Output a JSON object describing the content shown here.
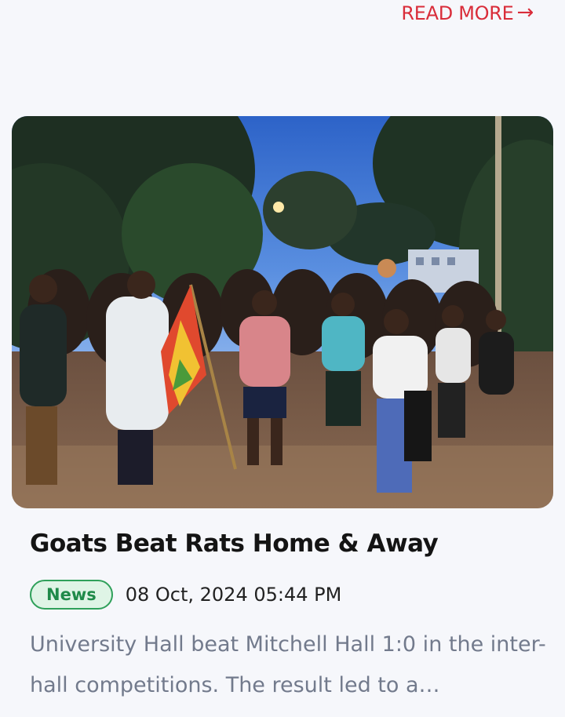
{
  "read_more": {
    "label": "READ MORE",
    "arrow": "→"
  },
  "article": {
    "image_icon": "photo-crowd-celebration",
    "title": "Goats Beat Rats Home & Away",
    "category": "News",
    "date": "08 Oct, 2024 05:44 PM",
    "excerpt": "University Hall beat Mitchell Hall 1:0 in the inter-hall competitions. The result led to a…"
  },
  "colors": {
    "accent_red": "#d92d3a",
    "badge_green": "#1f8a49",
    "badge_bg": "#dff4e6",
    "excerpt_gray": "#727a8c"
  }
}
